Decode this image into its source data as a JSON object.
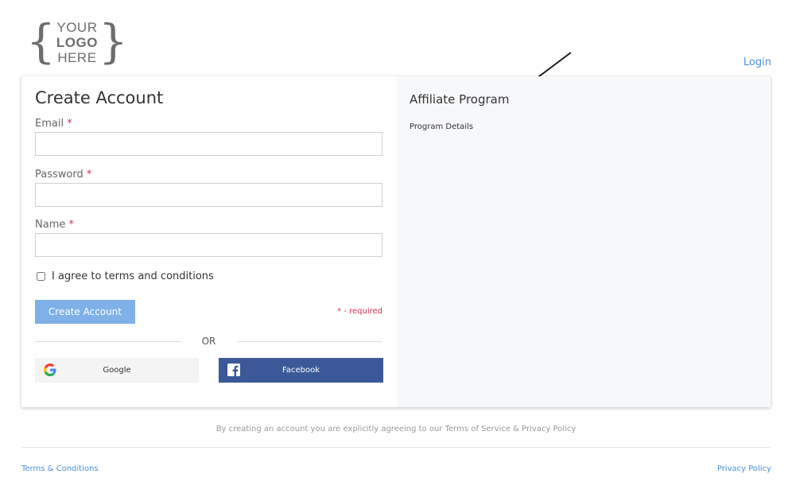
{
  "logo": {
    "line1": "YOUR",
    "line2": "LOGO",
    "line3": "HERE",
    "brace_open": "{",
    "brace_close": "}"
  },
  "header": {
    "login_label": "Login"
  },
  "form": {
    "title": "Create Account",
    "email_label": "Email",
    "email_value": "",
    "password_label": "Password",
    "password_value": "",
    "name_label": "Name",
    "name_value": "",
    "required_star": "*",
    "agree_label": "I agree to terms and conditions",
    "agree_checked": false,
    "submit_label": "Create Account",
    "required_note": "* - required",
    "or_label": "OR",
    "google_label": "Google",
    "facebook_label": "Facebook"
  },
  "affiliate": {
    "title": "Affiliate Program",
    "details_label": "Program Details"
  },
  "footer": {
    "agreement_text": "By creating an account you are explicitly agreeing to our Terms of Service & Privacy Policy",
    "terms_label": "Terms & Conditions",
    "privacy_label": "Privacy Policy"
  },
  "icons": {
    "google": "google-icon",
    "facebook": "facebook-icon",
    "arrow": "arrow-annotation-icon"
  },
  "colors": {
    "link": "#4a90d9",
    "button_primary": "#7fb0e8",
    "facebook": "#3b5998",
    "required": "#d9304f",
    "right_pane": "#f7f8fa"
  }
}
